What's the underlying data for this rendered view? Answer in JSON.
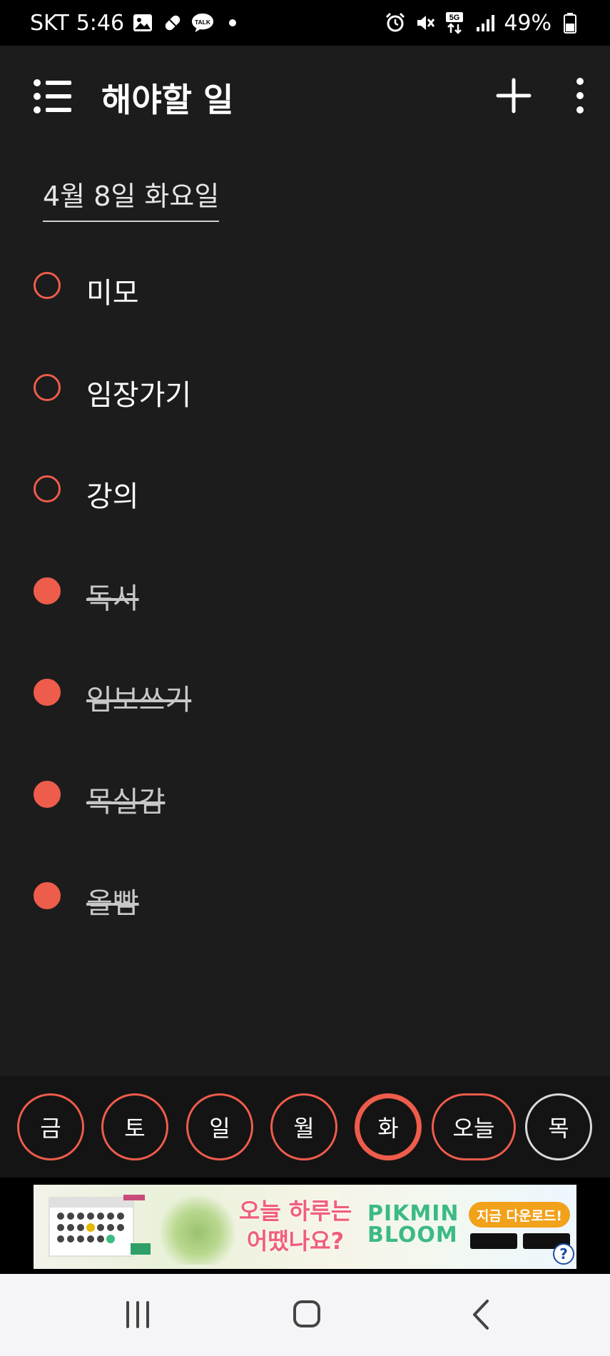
{
  "status_bar": {
    "carrier": "SKT",
    "time": "5:46",
    "talk_label": "TALK",
    "network": "5G",
    "battery": "49%"
  },
  "header": {
    "title": "해야할 일",
    "menu_icon": "list-icon",
    "add_icon": "plus-icon",
    "more_icon": "more-vertical-icon"
  },
  "date_label": "4월 8일 화요일",
  "tasks": [
    {
      "label": "미모",
      "done": false
    },
    {
      "label": "임장가기",
      "done": false
    },
    {
      "label": "강의",
      "done": false
    },
    {
      "label": "독서",
      "done": true
    },
    {
      "label": "임보쓰기",
      "done": true
    },
    {
      "label": "목실감",
      "done": true
    },
    {
      "label": "올빰",
      "done": true
    }
  ],
  "days": [
    {
      "label": "금",
      "state": "past"
    },
    {
      "label": "토",
      "state": "past"
    },
    {
      "label": "일",
      "state": "past"
    },
    {
      "label": "월",
      "state": "past"
    },
    {
      "label": "화",
      "state": "selected"
    },
    {
      "label": "오늘",
      "state": "today"
    },
    {
      "label": "목",
      "state": "future"
    }
  ],
  "ad": {
    "headline_line1": "오늘 하루는",
    "headline_line2": "어땠나요?",
    "brand_line1": "PIKMIN",
    "brand_line2": "BLOOM",
    "cta": "지금 다운로드!",
    "help": "?"
  },
  "colors": {
    "accent": "#ee5c4b",
    "background": "#1c1c1c",
    "daybar": "#141414"
  }
}
